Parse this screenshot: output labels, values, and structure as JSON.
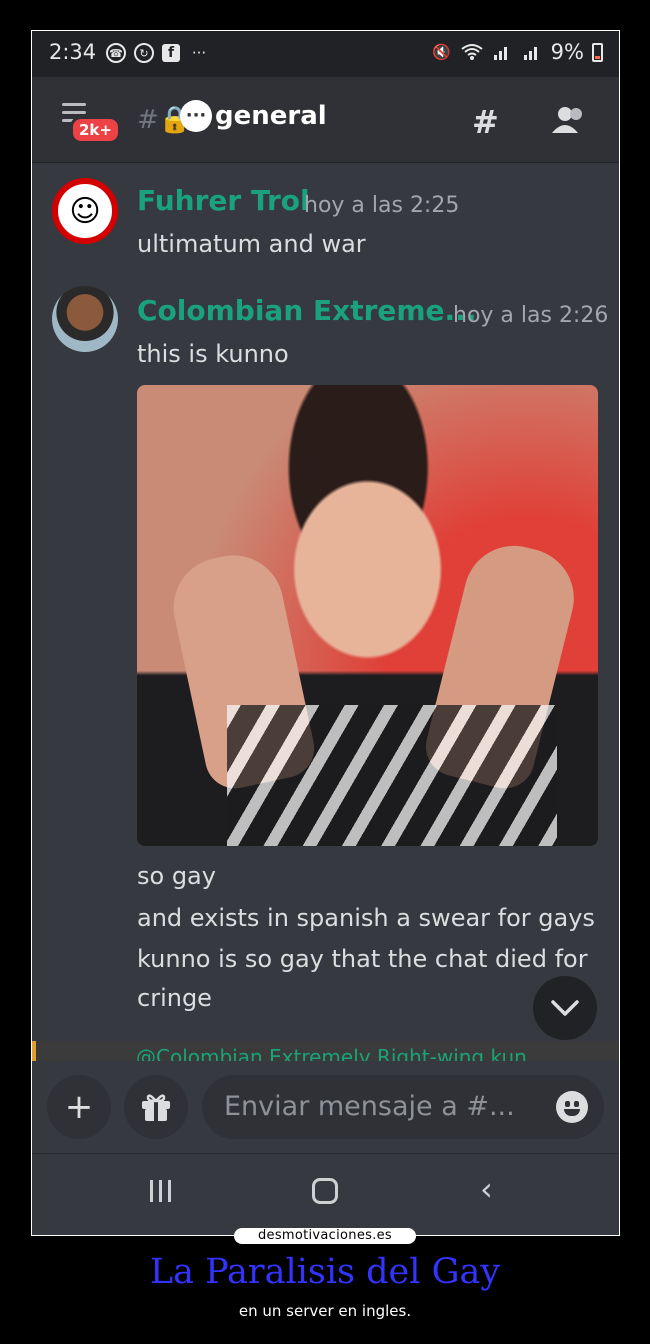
{
  "status_bar": {
    "time": "2:34",
    "battery": "9%"
  },
  "header": {
    "badge": "2k+",
    "channel_name": "general"
  },
  "messages": [
    {
      "author": "Fuhrer Trol",
      "timestamp": "hoy a las 2:25",
      "lines": [
        "ultimatum and war"
      ]
    },
    {
      "author": "Colombian Extreme...",
      "timestamp": "hoy a las 2:26",
      "lines": [
        "this is kunno",
        "so gay",
        "and exists in spanish a swear for gays",
        "kunno is so gay that the chat died for",
        "cringe"
      ]
    }
  ],
  "reply_preview": "@Colombian Extremely Right-wing kun",
  "composer": {
    "placeholder": "Enviar mensaje a #..."
  },
  "caption": {
    "site": "desmotivaciones.es",
    "title": "La Paralisis del Gay",
    "subtitle": "en un server en ingles."
  },
  "colors": {
    "author_name": "#1aa37a",
    "badge": "#ed4245",
    "caption_title": "#3333ff",
    "background": "#36393f"
  }
}
